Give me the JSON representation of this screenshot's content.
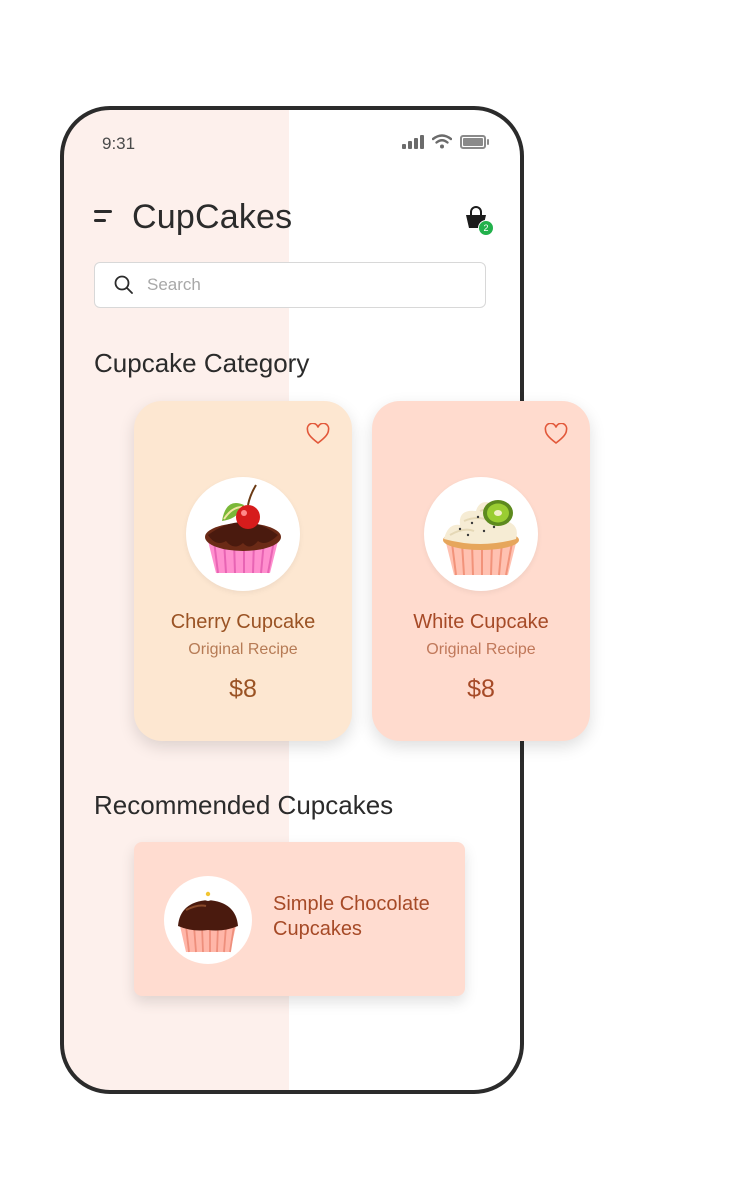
{
  "status_bar": {
    "time": "9:31"
  },
  "header": {
    "title": "CupCakes",
    "cart_count": "2"
  },
  "search": {
    "placeholder": "Search"
  },
  "categories": {
    "title": "Cupcake Category",
    "items": [
      {
        "name": "Cherry Cupcake",
        "subtitle": "Original Recipe",
        "price": "$8"
      },
      {
        "name": "White Cupcake",
        "subtitle": "Original Recipe",
        "price": "$8"
      }
    ]
  },
  "recommended": {
    "title": "Recommended Cupcakes",
    "items": [
      {
        "name": "Simple Chocolate Cupcakes"
      }
    ]
  },
  "colors": {
    "card_cherry_bg": "#fde7d1",
    "card_white_bg": "#ffdbce",
    "accent_text": "#9a5324",
    "badge": "#22b14c"
  }
}
